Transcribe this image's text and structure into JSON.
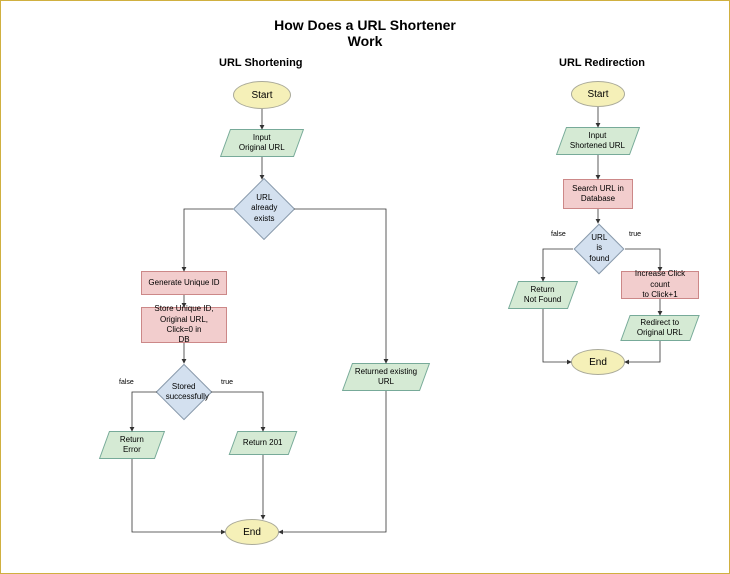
{
  "title": "How Does a URL Shortener\nWork",
  "left": {
    "heading": "URL Shortening",
    "start": "Start",
    "input": "Input\nOriginal URL",
    "decision1": "URL\nalready exists",
    "gen": "Generate Unique ID",
    "store": "Store Unique ID,\nOriginal URL, Click=0 in\nDB",
    "decision2": "Stored\nsuccessfully",
    "retErr": "Return\nError",
    "ret201": "Return 201",
    "retExisting": "Returned existing\nURL",
    "end": "End",
    "falseLbl": "false",
    "trueLbl": "true"
  },
  "right": {
    "heading": "URL Redirection",
    "start": "Start",
    "input": "Input\nShortened URL",
    "search": "Search URL in\nDatabase",
    "decision": "URL\nis found",
    "retNF": "Return\nNot Found",
    "inc": "Increase Click count\nto Click+1",
    "redirect": "Redirect to\nOriginal URL",
    "end": "End",
    "falseLbl": "false",
    "trueLbl": "true"
  }
}
